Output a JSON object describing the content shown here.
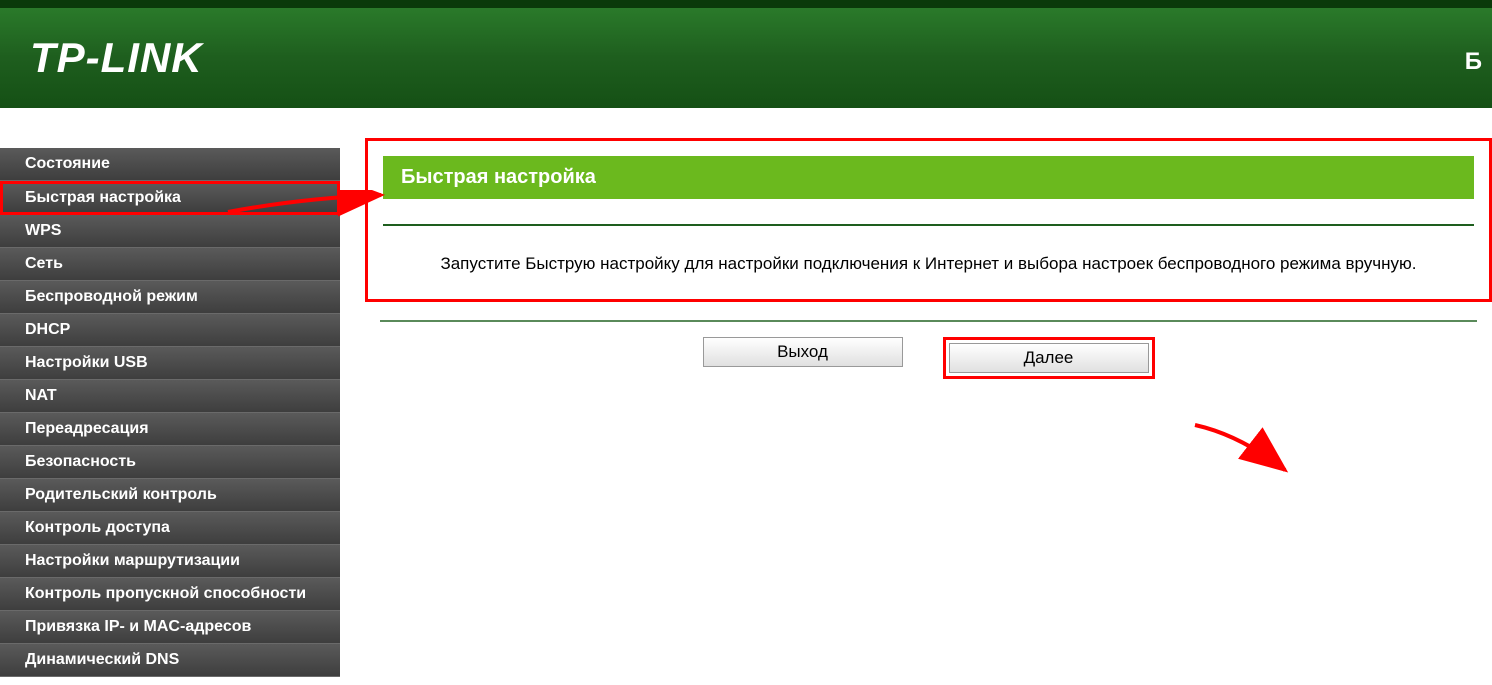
{
  "header": {
    "logo": "TP-LINK",
    "right_char": "Б"
  },
  "sidebar": {
    "items": [
      {
        "label": "Состояние"
      },
      {
        "label": "Быстрая настройка",
        "active": true
      },
      {
        "label": "WPS"
      },
      {
        "label": "Сеть"
      },
      {
        "label": "Беспроводной режим"
      },
      {
        "label": "DHCP"
      },
      {
        "label": "Настройки USB"
      },
      {
        "label": "NAT"
      },
      {
        "label": "Переадресация"
      },
      {
        "label": "Безопасность"
      },
      {
        "label": "Родительский контроль"
      },
      {
        "label": "Контроль доступа"
      },
      {
        "label": "Настройки маршрутизации"
      },
      {
        "label": "Контроль пропускной способности"
      },
      {
        "label": "Привязка IP- и MAC-адресов"
      },
      {
        "label": "Динамический DNS"
      }
    ]
  },
  "main": {
    "title": "Быстрая настройка",
    "description": "Запустите Быструю настройку для настройки подключения к Интернет и выбора настроек беспроводного режима вручную.",
    "buttons": {
      "exit": "Выход",
      "next": "Далее"
    }
  }
}
